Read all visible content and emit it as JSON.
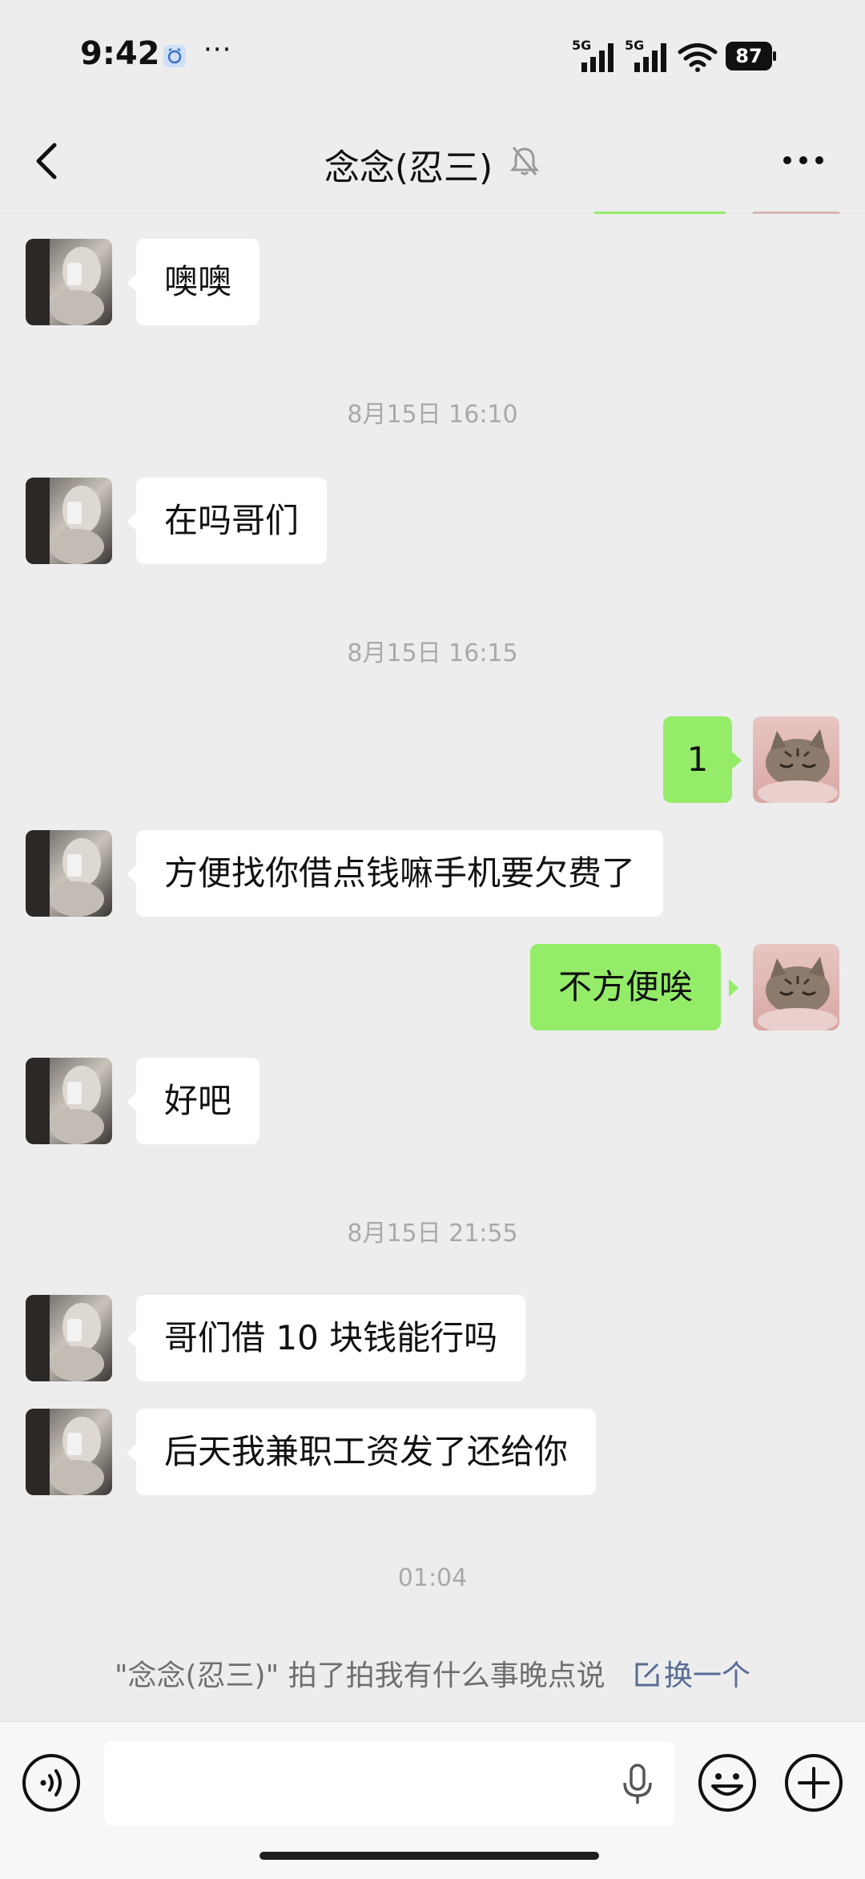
{
  "status_bar": {
    "time": "9:42",
    "dots": "···",
    "signal_1_label": "5G",
    "signal_2_label": "5G",
    "battery": "87"
  },
  "header": {
    "title": "念念(忍三)",
    "back_icon": "chevron-left-icon",
    "mute_icon": "bell-off-icon",
    "more_icon": "more-dots-icon"
  },
  "messages": [
    {
      "side": "left",
      "text": "噢噢"
    },
    {
      "side": "left",
      "text": "在吗哥们"
    },
    {
      "side": "right",
      "text": "1"
    },
    {
      "side": "left",
      "text": "方便找你借点钱嘛手机要欠费了"
    },
    {
      "side": "right",
      "text": "不方便唉"
    },
    {
      "side": "left",
      "text": "好吧"
    },
    {
      "side": "left",
      "text": "哥们借 10 块钱能行吗"
    },
    {
      "side": "left",
      "text": "后天我兼职工资发了还给你"
    }
  ],
  "timestamps": [
    "8月15日 16:10",
    "8月15日 16:15",
    "8月15日 21:55",
    "01:04"
  ],
  "pat": {
    "text": "\"念念(忍三)\" 拍了拍我有什么事晚点说",
    "action": "换一个"
  },
  "colors": {
    "background": "#ededed",
    "bubble_self": "#95ec69",
    "bubble_other": "#ffffff",
    "link": "#576b95"
  },
  "input_bar": {
    "voice_icon": "voice-icon",
    "mic_icon": "mic-icon",
    "emoji_icon": "emoji-icon",
    "plus_icon": "plus-icon"
  }
}
